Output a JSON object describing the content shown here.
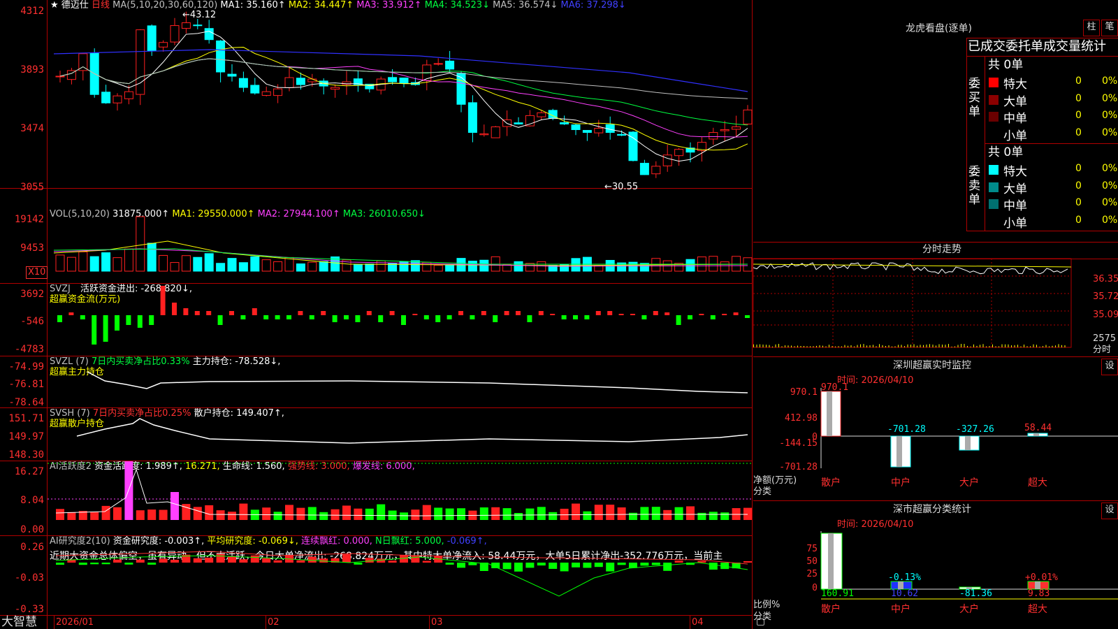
{
  "colors": {
    "up": "#ff2020",
    "down": "#00ffff",
    "bg": "#000000",
    "grid": "#b00000",
    "ma1": "#ffffff",
    "ma2": "#ffff00",
    "ma3": "#ff40ff",
    "ma4": "#00ff40",
    "ma5": "#c0c0c0",
    "ma6": "#2020ff",
    "yellow": "#ffff00",
    "green": "#00ff00"
  },
  "main": {
    "star": "★",
    "stock_name": "德迈仕",
    "period": "日线",
    "ma_label": "MA(5,10,20,30,60,120)",
    "ma": [
      {
        "label": "MA1: 35.160↑",
        "color": "#ffffff"
      },
      {
        "label": "MA2: 34.447↑",
        "color": "#ffff00"
      },
      {
        "label": "MA3: 33.912↑",
        "color": "#ff40ff"
      },
      {
        "label": "MA4: 34.523↓",
        "color": "#00ff40"
      },
      {
        "label": "MA5: 36.574↓",
        "color": "#c0c0c0"
      },
      {
        "label": "MA6: 37.298↓",
        "color": "#2020ff"
      }
    ],
    "price_ticks": [
      "4312",
      "3893",
      "3474",
      "3055"
    ],
    "high_mark": "43.12",
    "low_mark": "←30.55",
    "high_arrow": "←"
  },
  "vol": {
    "title": "VOL(5,10,20)",
    "value": "31875.000↑",
    "ma1": "MA1: 29550.000↑",
    "ma2": "MA2: 27944.100↑",
    "ma3": "MA3: 26010.650↓",
    "ticks": [
      "19142",
      "9453"
    ],
    "unit": "X10"
  },
  "svzj": {
    "title": "SVZJ",
    "label": "活跃资金进出: -268.820↓,",
    "sub": "超赢资金流(万元)",
    "ticks": [
      "3692",
      "-546",
      "-4783"
    ]
  },
  "svzl": {
    "title": "SVZL (7)",
    "ratio": "7日内买卖净占比0.33%",
    "label": "主力持仓: -78.528↓,",
    "sub": "超赢主力持仓",
    "ticks": [
      "-74.99",
      "-76.81",
      "-78.64"
    ]
  },
  "svsh": {
    "title": "SVSH (7)",
    "ratio": "7日内买卖净占比0.25%",
    "label": "散户持仓: 149.407↑,",
    "sub": "超赢散户持仓",
    "ticks": [
      "151.71",
      "149.97",
      "148.30"
    ]
  },
  "ai1": {
    "title": "AI活跃度2",
    "a": "资金活跃度: 1.989↑,",
    "b": "16.271,",
    "c": "生命线: 1.560,",
    "d": "强势线: 3.000,",
    "e": "爆发线: 6.000,",
    "ticks": [
      "16.27",
      "8.04",
      "0.00"
    ]
  },
  "ai2": {
    "title": "AI研究度2(10)",
    "a": "资金研究度: -0.003↑,",
    "b": "平均研究度: -0.069↓,",
    "c": "连续飘红: 0.000,",
    "d": "N日飘红: 5.000,",
    "e": "-0.069↑,",
    "desc": "近期大资金总体偏空，虽有异动，但不太活跃，今日大单净流出: -268.824万元，其中特大单净流入: 58.44万元，大单5日累计净出-352.776万元，当前主",
    "ticks": [
      "0.26",
      "-0.03",
      "-0.33"
    ]
  },
  "xaxis": {
    "brand": "大智慧",
    "dates": [
      "2026/01",
      "02",
      "03",
      "04"
    ]
  },
  "right": {
    "dragon_title": "龙虎看盘(逐单)",
    "btn_zhu": "柱",
    "btn_bi": "笔",
    "stats_title": "已成交委托单成交量统计",
    "buy_group": "委买单",
    "sell_group": "委卖单",
    "buy_total": "共 0单",
    "sell_total": "共 0单",
    "buy_rows": [
      {
        "name": "特大",
        "count": "0",
        "pct": "0%",
        "color": "#ff0000"
      },
      {
        "name": "大单",
        "count": "0",
        "pct": "0%",
        "color": "#8b0000"
      },
      {
        "name": "中单",
        "count": "0",
        "pct": "0%",
        "color": "#6a0000"
      },
      {
        "name": "小单",
        "count": "0",
        "pct": "0%",
        "color": ""
      }
    ],
    "sell_rows": [
      {
        "name": "特大",
        "count": "0",
        "pct": "0%",
        "color": "#00ffff"
      },
      {
        "name": "大单",
        "count": "0",
        "pct": "0%",
        "color": "#008b8b"
      },
      {
        "name": "中单",
        "count": "0",
        "pct": "0%",
        "color": "#007070"
      },
      {
        "name": "小单",
        "count": "0",
        "pct": "0%",
        "color": ""
      }
    ],
    "intraday_title": "分时走势",
    "intraday_ticks": [
      "36.35",
      "35.72",
      "35.09",
      "2575",
      "分时"
    ],
    "monitor_title": "深圳超赢实时监控",
    "monitor_btn": "设",
    "monitor_time": "时间: 2026/04/10",
    "monitor_ticks": [
      "970.1",
      "412.98",
      "0",
      "-144.15",
      "-701.28"
    ],
    "monitor_unit": "净额(万元)",
    "monitor_cat": "分类",
    "monitor_bars": [
      {
        "name": "散户",
        "value": "970.1"
      },
      {
        "name": "中户",
        "value": "-701.28"
      },
      {
        "name": "大户",
        "value": "-327.26"
      },
      {
        "name": "超大",
        "value": "58.44"
      }
    ],
    "class_title": "深市超赢分类统计",
    "class_btn": "设",
    "class_time": "时间: 2026/04/10",
    "class_ticks": [
      "75",
      "50",
      "25",
      "0"
    ],
    "class_unit": "比例%",
    "class_cat": "分类",
    "class_bars": [
      {
        "name": "散户",
        "top": "",
        "bottom": "160.91"
      },
      {
        "name": "中户",
        "top": "-0.13%",
        "bottom": "10.62"
      },
      {
        "name": "大户",
        "top": "",
        "bottom": "-81.36"
      },
      {
        "name": "超大",
        "top": "+0.01%",
        "bottom": "9.83"
      }
    ]
  }
}
